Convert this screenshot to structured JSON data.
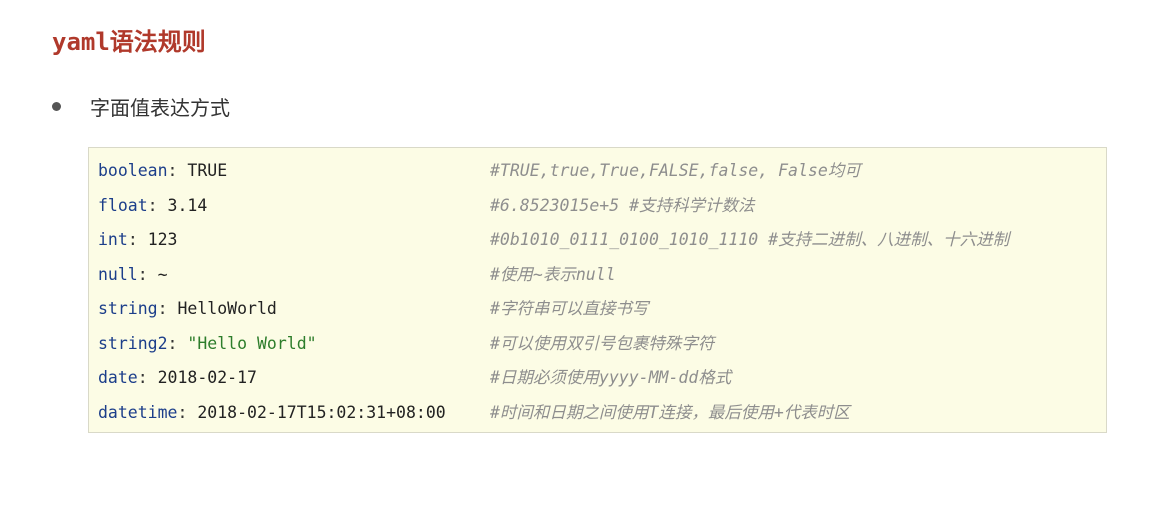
{
  "page": {
    "title": "yaml语法规则",
    "bullet": "字面值表达方式"
  },
  "code": {
    "lines": [
      {
        "key": "boolean",
        "colon": ": ",
        "value": "TRUE",
        "comment": "#TRUE,true,True,FALSE,false, False均可"
      },
      {
        "key": "float",
        "colon": ": ",
        "value": "3.14",
        "comment": "#6.8523015e+5  #支持科学计数法"
      },
      {
        "key": "int",
        "colon": ": ",
        "value": "123",
        "comment": "#0b1010_0111_0100_1010_1110    #支持二进制、八进制、十六进制"
      },
      {
        "key": "null",
        "colon": ": ",
        "value": "~",
        "comment": "#使用~表示null"
      },
      {
        "key": "string",
        "colon": ": ",
        "value": "HelloWorld",
        "comment": "#字符串可以直接书写"
      },
      {
        "key": "string2",
        "colon": ": ",
        "value": "\"Hello World\"",
        "comment": "#可以使用双引号包裹特殊字符"
      },
      {
        "key": "date",
        "colon": ": ",
        "value": "2018-02-17",
        "comment": "#日期必须使用yyyy-MM-dd格式"
      },
      {
        "key": "datetime",
        "colon": ": ",
        "value": "2018-02-17T15:02:31+08:00",
        "comment": "#时间和日期之间使用T连接，最后使用+代表时区"
      }
    ]
  },
  "colors": {
    "title": "#b0392b",
    "code_background": "#fcfce5",
    "key": "#1c3e8a",
    "string_value": "#2d7d2b",
    "comment": "#8e8e8e"
  }
}
